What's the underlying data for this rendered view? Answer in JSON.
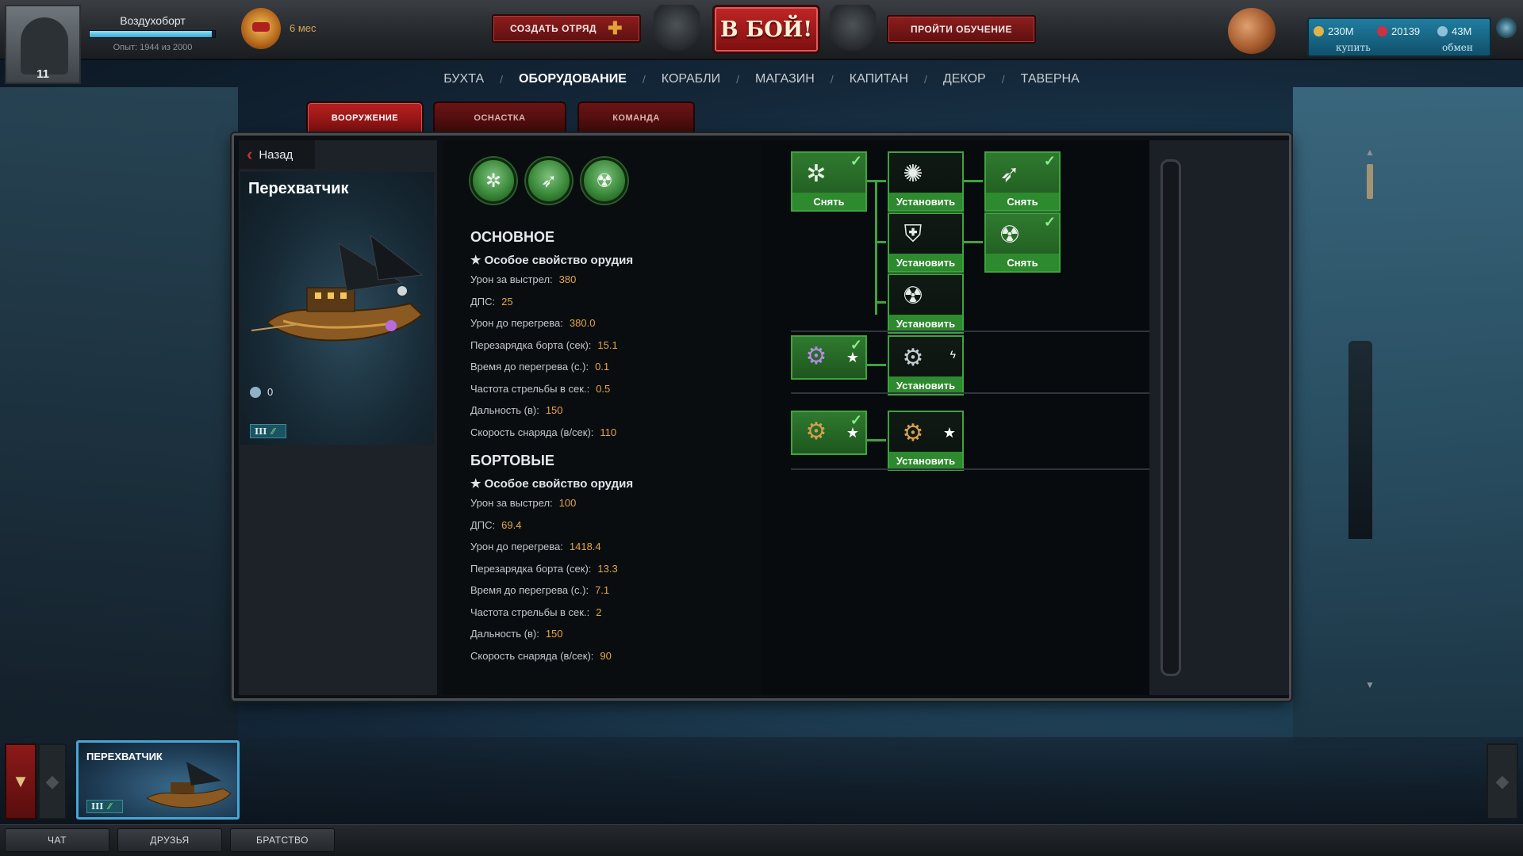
{
  "player": {
    "name": "Воздухоборт",
    "level": "11",
    "xp_text": "Опыт: 1944 из 2000",
    "xp_fraction": 0.972,
    "premium": "6 мес"
  },
  "topbar": {
    "create_squad": "СОЗДАТЬ ОТРЯД",
    "battle": "В БОЙ!",
    "tutorial": "ПРОЙТИ ОБУЧЕНИЕ"
  },
  "currency": {
    "gold": "230M",
    "rubies": "20139",
    "silver": "43M",
    "buy": "купить",
    "exchange": "обмен"
  },
  "nav": {
    "items": [
      "БУХТА",
      "ОБОРУДОВАНИЕ",
      "КОРАБЛИ",
      "МАГАЗИН",
      "КАПИТАН",
      "ДЕКОР",
      "ТАВЕРНА"
    ],
    "active": "ОБОРУДОВАНИЕ"
  },
  "subtabs": {
    "weapons": "ВООРУЖЕНИЕ",
    "rigging": "ОСНАСТКА",
    "crew": "КОМАНДА",
    "active": "ВООРУЖЕНИЕ"
  },
  "ship": {
    "back": "Назад",
    "name": "Перехватчик",
    "crew": "0",
    "tier": "III"
  },
  "main_stats": {
    "title": "ОСНОВНОЕ",
    "special": "Особое свойство орудия",
    "rows": [
      {
        "label": "Урон за выстрел:",
        "value": "380"
      },
      {
        "label": "ДПС:",
        "value": "25"
      },
      {
        "label": "Урон до перегрева:",
        "value": "380.0"
      },
      {
        "label": "Перезарядка борта (сек):",
        "value": "15.1"
      },
      {
        "label": "Время до перегрева (с.):",
        "value": "0.1"
      },
      {
        "label": "Частота стрельбы в сек.:",
        "value": "0.5"
      },
      {
        "label": "Дальность (в):",
        "value": "150"
      },
      {
        "label": "Скорость снаряда (в/сек):",
        "value": "110"
      }
    ]
  },
  "side_stats": {
    "title": "БОРТОВЫЕ",
    "special": "Особое свойство орудия",
    "rows": [
      {
        "label": "Урон за выстрел:",
        "value": "100"
      },
      {
        "label": "ДПС:",
        "value": "69.4"
      },
      {
        "label": "Урон до перегрева:",
        "value": "1418.4"
      },
      {
        "label": "Перезарядка борта (сек):",
        "value": "13.3"
      },
      {
        "label": "Время до перегрева (с.):",
        "value": "7.1"
      },
      {
        "label": "Частота стрельбы в сек.:",
        "value": "2"
      },
      {
        "label": "Дальность (в):",
        "value": "150"
      },
      {
        "label": "Скорость снаряда (в/сек):",
        "value": "90"
      }
    ]
  },
  "tree": {
    "remove": "Снять",
    "install": "Установить"
  },
  "ship_strip": {
    "ship_name": "ПЕРЕХВАТЧИК",
    "tier": "III"
  },
  "bottom_tabs": {
    "chat": "ЧАТ",
    "friends": "ДРУЗЬЯ",
    "guild": "БРАТСТВО"
  },
  "colors": {
    "accent_red": "#b82020",
    "tree_green": "#3ea43e",
    "stat_value": "#e3a54a",
    "currency_blue": "#1f7ea0"
  }
}
